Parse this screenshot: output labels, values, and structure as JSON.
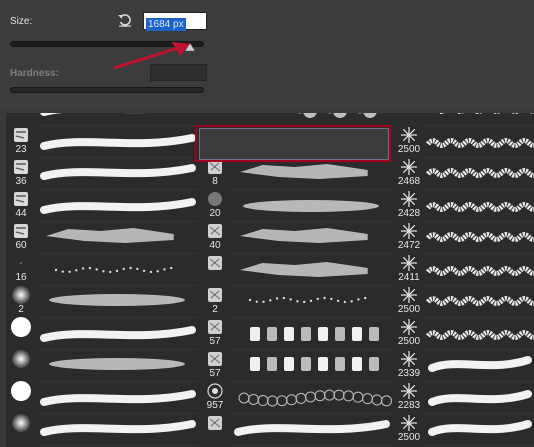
{
  "panel": {
    "size_label": "Size:",
    "size_value": "1684 px",
    "hardness_label": "Hardness:",
    "size_slider_fraction": 0.93
  },
  "presets": {
    "col1": [
      "23",
      "36",
      "44",
      "60",
      "16",
      "2",
      "",
      "",
      "",
      ""
    ],
    "col2": [
      "500",
      "8",
      "20",
      "40",
      "",
      "2",
      "57",
      "57",
      "957",
      ""
    ],
    "col3": [
      "2500",
      "2468",
      "2428",
      "2472",
      "2411",
      "2500",
      "2500",
      "2339",
      "2283",
      "2500"
    ]
  },
  "colors": {
    "selection": "#a4001d",
    "arrow": "#c0142e",
    "highlight": "#1e64c6"
  }
}
